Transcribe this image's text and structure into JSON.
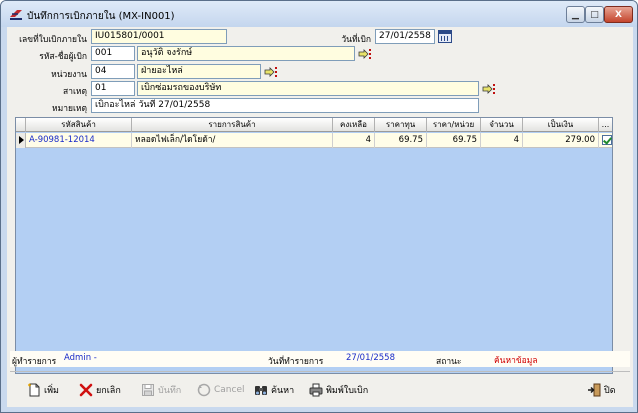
{
  "window": {
    "title": "บันทึกการเบิกภายใน (MX-IN001)",
    "controls": {
      "minimize": "▁",
      "maximize": "□",
      "close": "X"
    }
  },
  "form": {
    "doc_no": {
      "label": "เลขที่ใบเบิกภายใน",
      "value": "IU015801/0001"
    },
    "date": {
      "label": "วันที่เบิก",
      "value": "27/01/2558"
    },
    "requester": {
      "label": "รหัส-ชื่อผู้เบิก",
      "code": "001",
      "name": "อนุวัติ จงรักษ์"
    },
    "department": {
      "label": "หน่วยงาน",
      "code": "04",
      "name": "ฝ่ายอะไหล่"
    },
    "reason": {
      "label": "สาเหตุ",
      "code": "01",
      "name": "เบิกซ่อมรถของบริษัท"
    },
    "remark": {
      "label": "หมายเหตุ",
      "value": "เบิกอะไหล่ วันที่ 27/01/2558"
    }
  },
  "grid": {
    "headers": [
      "รหัสสินค้า",
      "รายการสินค้า",
      "คงเหลือ",
      "ราคาทุน",
      "ราคา/หน่วย",
      "จำนวน",
      "เป็นเงิน",
      "..."
    ],
    "rows": [
      {
        "code": "A-90981-12014",
        "name": "หลอดไฟเล็ก/ไดโยด้า/",
        "remain": "4",
        "cost": "69.75",
        "unit_price": "69.75",
        "qty": "4",
        "amount": "279.00"
      }
    ]
  },
  "status": {
    "recorder_label": "ผู้ทำรายการ",
    "recorder_value": "Admin -",
    "record_date_label": "วันที่ทำรายการ",
    "record_date_value": "27/01/2558",
    "state_label": "สถานะ",
    "state_value": "ค้นหาข้อมูล"
  },
  "toolbar": {
    "add": "เพิ่ม",
    "cancel_doc": "ยกเลิก",
    "save": "บันทึก",
    "cancel": "Cancel",
    "search": "ค้นหา",
    "print": "พิมพ์ใบเบิก",
    "close": "ปิด"
  },
  "colors": {
    "grid_bg": "#b3cff3",
    "row_bg": "#fffde8",
    "field_yellow": "#fffde0",
    "status_blue": "#1a2bc8",
    "status_red": "#d00000",
    "code_blue": "#1a2bc8"
  }
}
